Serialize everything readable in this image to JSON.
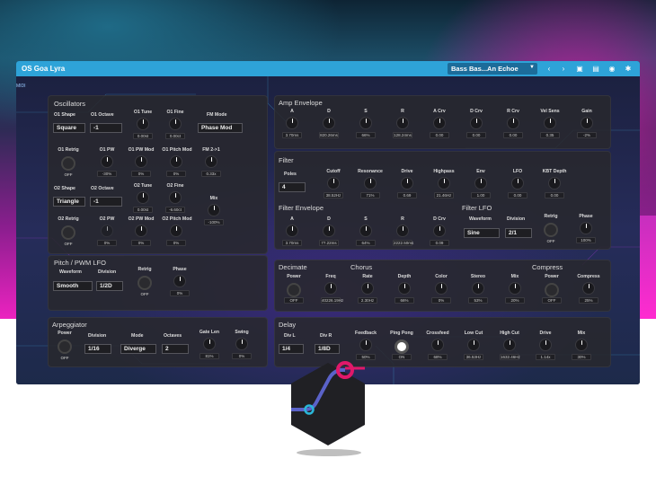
{
  "app": {
    "title": "OS Goa Lyra",
    "preset": "Bass Bas...An Echoe",
    "sidebar_tag": "MIDI"
  },
  "osc": {
    "title": "Oscillators",
    "o1shape_l": "O1 Shape",
    "o1shape_v": "Square",
    "o1oct_l": "O1 Octave",
    "o1oct_v": "-1",
    "o1tune_l": "O1 Tune",
    "o1tune_v": "0.00st",
    "o1fine_l": "O1 Fine",
    "o1fine_v": "0.00ct",
    "fmmode_l": "FM Mode",
    "fmmode_v": "Phase Mod",
    "o1retrig_l": "O1 Retrig",
    "o1retrig_v": "OFF",
    "o1pw_l": "O1 PW",
    "o1pw_v": "-30%",
    "o1pwmod_l": "O1 PW Mod",
    "o1pwmod_v": "0%",
    "o1pitchmod_l": "O1 Pitch Mod",
    "o1pitchmod_v": "0%",
    "fm21_l": "FM 2->1",
    "fm21_v": "0.33x",
    "o2shape_l": "O2 Shape",
    "o2shape_v": "Triangle",
    "o2oct_l": "O2 Octave",
    "o2oct_v": "-1",
    "o2tune_l": "O2 Tune",
    "o2tune_v": "0.00st",
    "o2fine_l": "O2 Fine",
    "o2fine_v": "-6.60ct",
    "mix_l": "Mix",
    "mix_v": "-100%",
    "o2retrig_l": "O2 Retrig",
    "o2retrig_v": "OFF",
    "o2pw_l": "O2 PW",
    "o2pw_v": "0%",
    "o2pwmod_l": "O2 PW Mod",
    "o2pwmod_v": "0%",
    "o2pitchmod_l": "O2 Pitch Mod",
    "o2pitchmod_v": "0%"
  },
  "pitchlfo": {
    "title": "Pitch / PWM LFO",
    "wave_l": "Waveform",
    "wave_v": "Smooth",
    "div_l": "Division",
    "div_v": "1/2D",
    "retrig_l": "Retrig",
    "retrig_v": "OFF",
    "phase_l": "Phase",
    "phase_v": "0%"
  },
  "ampenv": {
    "title": "Amp Envelope",
    "knobs": [
      {
        "l": "A",
        "v": "3.70ms"
      },
      {
        "l": "D",
        "v": "820.26ms"
      },
      {
        "l": "S",
        "v": "66%"
      },
      {
        "l": "R",
        "v": "128.24ms"
      },
      {
        "l": "A Crv",
        "v": "0.00"
      },
      {
        "l": "D Crv",
        "v": "0.00"
      },
      {
        "l": "R Crv",
        "v": "0.00"
      },
      {
        "l": "Vel Sens",
        "v": "0.35"
      },
      {
        "l": "Gain",
        "v": "-2%"
      }
    ]
  },
  "filter": {
    "title": "Filter",
    "poles_l": "Poles",
    "poles_v": "4",
    "knobs": [
      {
        "l": "Cutoff",
        "v": "38.52Hz"
      },
      {
        "l": "Resonance",
        "v": "71%"
      },
      {
        "l": "Drive",
        "v": "0.69"
      },
      {
        "l": "Highpass",
        "v": "21.46Hz"
      },
      {
        "l": "Env",
        "v": "1.00"
      },
      {
        "l": "LFO",
        "v": "0.00"
      },
      {
        "l": "KBT Depth",
        "v": "0.00"
      }
    ]
  },
  "fenv": {
    "title": "Filter Envelope",
    "knobs": [
      {
        "l": "A",
        "v": "3.70ms"
      },
      {
        "l": "D",
        "v": "77.22ms"
      },
      {
        "l": "S",
        "v": "64%"
      },
      {
        "l": "R",
        "v": "2222.50ms"
      },
      {
        "l": "D Crv",
        "v": "0.09"
      }
    ]
  },
  "flfo": {
    "title": "Filter LFO",
    "wave_l": "Waveform",
    "wave_v": "Sine",
    "div_l": "Division",
    "div_v": "2/1",
    "retrig_l": "Retrig",
    "retrig_v": "OFF",
    "phase_l": "Phase",
    "phase_v": "100%"
  },
  "fx": {
    "decimate": "Decimate",
    "chorus": "Chorus",
    "compress": "Compress",
    "knobs": [
      {
        "l": "Power",
        "v": "OFF"
      },
      {
        "l": "Freq",
        "v": "40226.19Hz"
      },
      {
        "l": "Rate",
        "v": "2.30Hz"
      },
      {
        "l": "Depth",
        "v": "66%"
      },
      {
        "l": "Color",
        "v": "0%"
      },
      {
        "l": "Stereo",
        "v": "53%"
      },
      {
        "l": "Mix",
        "v": "20%"
      },
      {
        "l": "Power",
        "v": "OFF"
      },
      {
        "l": "Compress",
        "v": "25%"
      }
    ]
  },
  "arp": {
    "title": "Arpeggiator",
    "power_l": "Power",
    "power_v": "OFF",
    "div_l": "Division",
    "div_v": "1/16",
    "mode_l": "Mode",
    "mode_v": "Diverge",
    "oct_l": "Octaves",
    "oct_v": "2",
    "gate_l": "Gate Len",
    "gate_v": "81%",
    "swing_l": "Swing",
    "swing_v": "0%"
  },
  "delay": {
    "title": "Delay",
    "divl_l": "Div L",
    "divl_v": "1/4",
    "divr_l": "Div R",
    "divr_v": "1/8D",
    "knobs": [
      {
        "l": "Feedback",
        "v": "50%"
      },
      {
        "l": "Ping Pong",
        "v": "ON"
      },
      {
        "l": "Crossfeed",
        "v": "68%"
      },
      {
        "l": "Low Cut",
        "v": "36.53Hz"
      },
      {
        "l": "High Cut",
        "v": "1632.46Hz"
      },
      {
        "l": "Drive",
        "v": "1.14x"
      },
      {
        "l": "Mix",
        "v": "30%"
      }
    ]
  },
  "colors": {
    "accent": "#2ea3d8",
    "logo_pink": "#e0186a",
    "logo_cyan": "#2ab6d8"
  }
}
